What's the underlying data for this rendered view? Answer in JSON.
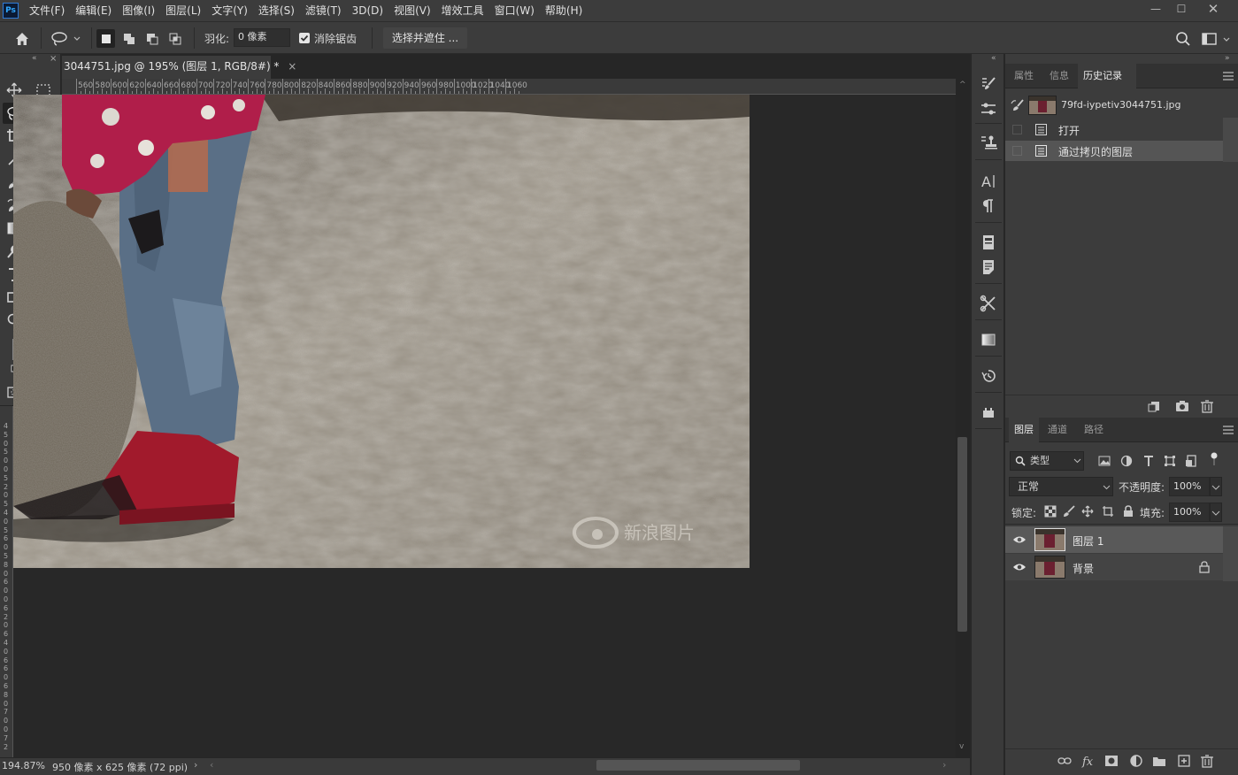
{
  "app": {
    "logo": "Ps"
  },
  "menu": [
    "文件(F)",
    "编辑(E)",
    "图像(I)",
    "图层(L)",
    "文字(Y)",
    "选择(S)",
    "滤镜(T)",
    "3D(D)",
    "视图(V)",
    "增效工具",
    "窗口(W)",
    "帮助(H)"
  ],
  "options": {
    "feather_label": "羽化:",
    "feather_value": "0 像素",
    "antialias_label": "消除锯齿",
    "select_mask_label": "选择并遮住 ..."
  },
  "document": {
    "tab_title": "3044751.jpg @ 195% (图层 1, RGB/8#) *",
    "close_glyph": "×"
  },
  "ruler_h": [
    "560",
    "580",
    "600",
    "620",
    "640",
    "660",
    "680",
    "700",
    "720",
    "740",
    "760",
    "780",
    "800",
    "820",
    "840",
    "860",
    "880",
    "900",
    "920",
    "940",
    "960",
    "980",
    "1000",
    "1020",
    "1040",
    "1060"
  ],
  "ruler_v": [
    "4",
    "5",
    "0",
    "5",
    "0",
    "0",
    "5",
    "2",
    "0",
    "5",
    "4",
    "0",
    "5",
    "6",
    "0",
    "5",
    "8",
    "0",
    "6",
    "0",
    "0",
    "6",
    "2",
    "0",
    "6",
    "4",
    "0",
    "6",
    "6",
    "0",
    "6",
    "8",
    "0",
    "7",
    "0",
    "0",
    "7",
    "2"
  ],
  "status": {
    "zoom": "194.87%",
    "doc_info": "950 像素 x 625 像素 (72 ppi)"
  },
  "history_panel": {
    "tabs": [
      "属性",
      "信息",
      "历史记录"
    ],
    "active_tab": "历史记录",
    "snapshot_name": "79fd-iypetiv3044751.jpg",
    "steps": [
      "打开",
      "通过拷贝的图层"
    ]
  },
  "layers_panel": {
    "tabs": [
      "图层",
      "通道",
      "路径"
    ],
    "active_tab": "图层",
    "filter_kind": "类型",
    "blend_mode": "正常",
    "opacity_label": "不透明度:",
    "opacity_value": "100%",
    "lock_label": "锁定:",
    "fill_label": "填充:",
    "fill_value": "100%",
    "layers": [
      {
        "name": "图层 1",
        "selected": true,
        "locked": false
      },
      {
        "name": "背景",
        "selected": false,
        "locked": true
      }
    ]
  },
  "watermark": "新浪图片",
  "colors": {
    "foreground": "#111111",
    "background": "#3f83b5",
    "accent": "#31a8ff"
  }
}
